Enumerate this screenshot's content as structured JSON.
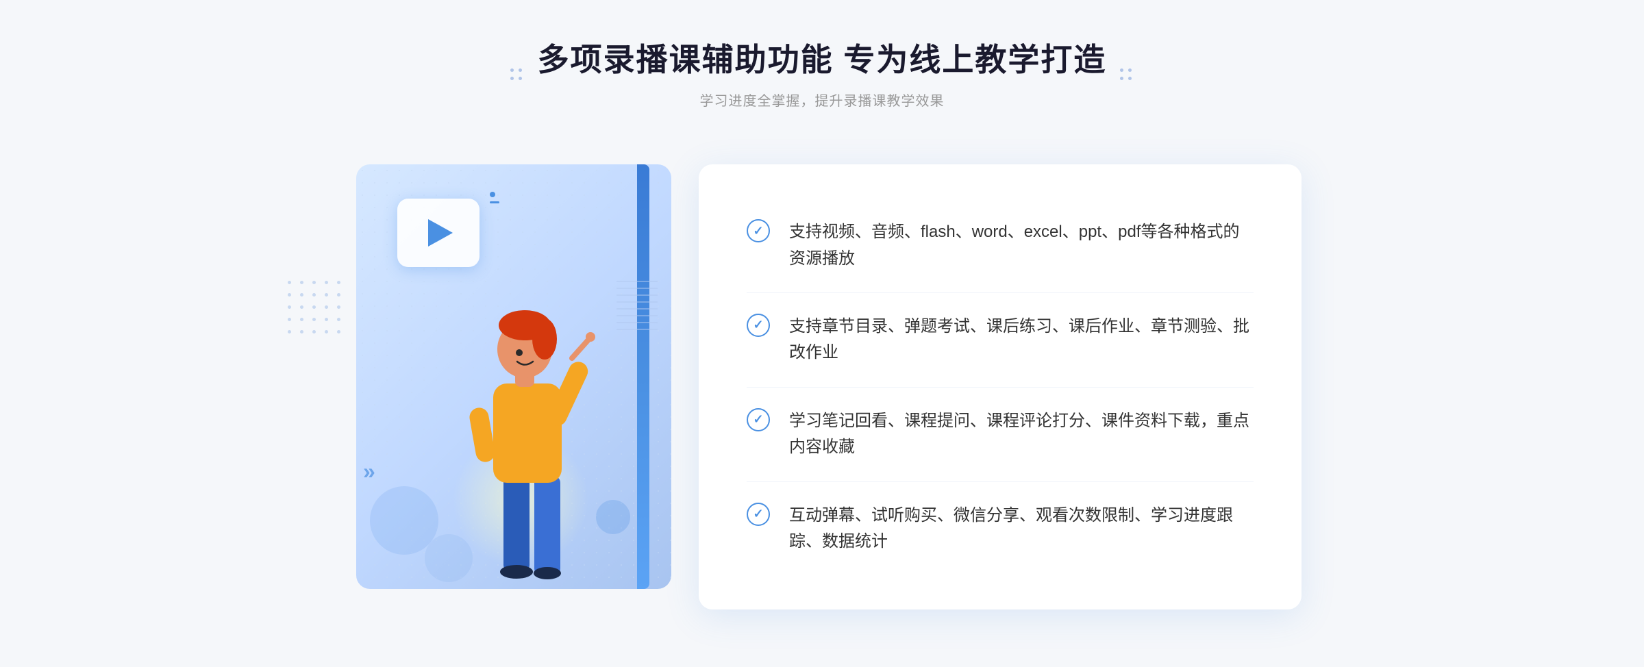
{
  "header": {
    "title": "多项录播课辅助功能 专为线上教学打造",
    "subtitle": "学习进度全掌握，提升录播课教学效果",
    "dots_left": "decorative-dots-left",
    "dots_right": "decorative-dots-right"
  },
  "features": [
    {
      "id": 1,
      "text": "支持视频、音频、flash、word、excel、ppt、pdf等各种格式的资源播放"
    },
    {
      "id": 2,
      "text": "支持章节目录、弹题考试、课后练习、课后作业、章节测验、批改作业"
    },
    {
      "id": 3,
      "text": "学习笔记回看、课程提问、课程评论打分、课件资料下载，重点内容收藏"
    },
    {
      "id": 4,
      "text": "互动弹幕、试听购买、微信分享、观看次数限制、学习进度跟踪、数据统计"
    }
  ],
  "colors": {
    "primary_blue": "#4a90e2",
    "light_blue": "#d6e8ff",
    "dark_text": "#1a1a2e",
    "gray_text": "#999999",
    "body_text": "#333333"
  }
}
